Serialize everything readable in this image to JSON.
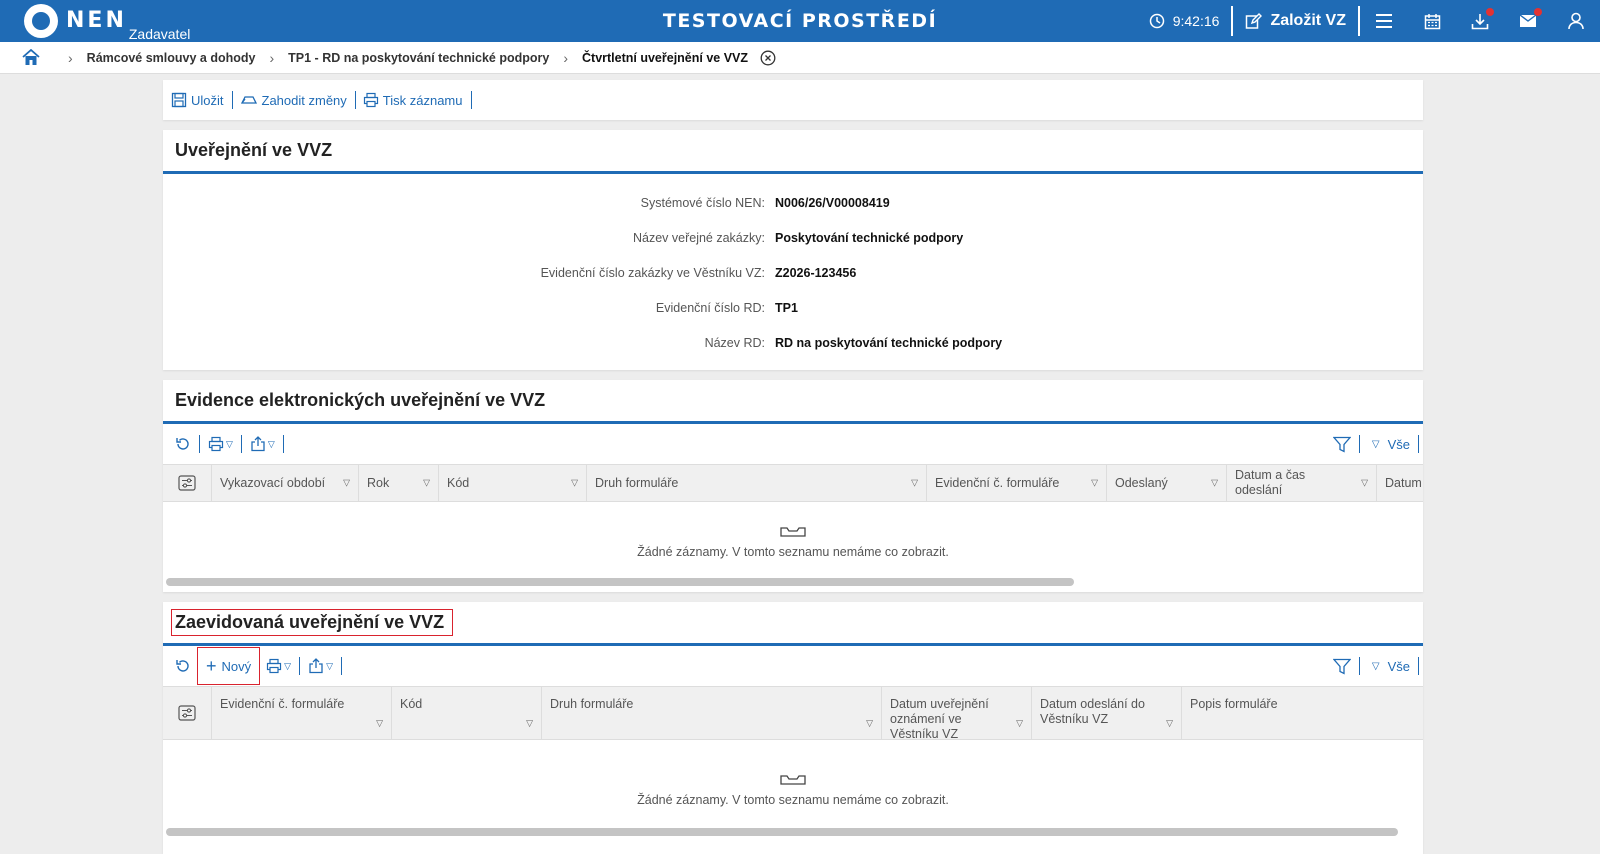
{
  "topbar": {
    "logo_text": "NEN",
    "logo_sub": "Zadavatel",
    "title": "TESTOVACÍ PROSTŘEDÍ",
    "time": "9:42:16",
    "create_label": "Založit VZ",
    "icons": [
      "clock-icon",
      "edit-icon",
      "menu-icon",
      "calendar-icon",
      "download-icon",
      "mail-icon",
      "user-icon"
    ],
    "accent": "#1f6bb5",
    "badge_color": "#e23232"
  },
  "breadcrumb": {
    "items": [
      "Rámcové smlouvy a dohody",
      "TP1 - RD na poskytování technické podpory"
    ],
    "current": "Čtvrtletní uveřejnění ve VVZ"
  },
  "toolbar": {
    "save_label": "Uložit",
    "discard_label": "Zahodit změny",
    "print_label": "Tisk záznamu"
  },
  "info": {
    "title": "Uveřejnění ve VVZ",
    "rows": [
      {
        "label": "Systémové číslo NEN:",
        "value": "N006/26/V00008419"
      },
      {
        "label": "Název veřejné zakázky:",
        "value": "Poskytování technické podpory"
      },
      {
        "label": "Evidenční číslo zakázky ve Věstníku VZ:",
        "value": "Z2026-123456"
      },
      {
        "label": "Evidenční číslo RD:",
        "value": "TP1"
      },
      {
        "label": "Název RD:",
        "value": "RD na poskytování technické podpory"
      }
    ]
  },
  "list1": {
    "title": "Evidence elektronických uveřejnění ve VVZ",
    "filter_all": "Vše",
    "columns": [
      "Vykazovací období",
      "Rok",
      "Kód",
      "Druh formuláře",
      "Evidenční č. formuláře",
      "Odeslaný",
      "Datum a čas odeslání",
      "Datum uveřejnění"
    ],
    "empty_text": "Žádné záznamy. V tomto seznamu nemáme co zobrazit."
  },
  "list2": {
    "title": "Zaevidovaná uveřejnění ve VVZ",
    "new_label": "Nový",
    "filter_all": "Vše",
    "columns": [
      "Evidenční č. formuláře",
      "Kód",
      "Druh formuláře",
      "Datum uveřejnění oznámení ve Věstníku VZ",
      "Datum odeslání do Věstníku VZ",
      "Popis formuláře"
    ],
    "empty_text": "Žádné záznamy. V tomto seznamu nemáme co zobrazit."
  }
}
